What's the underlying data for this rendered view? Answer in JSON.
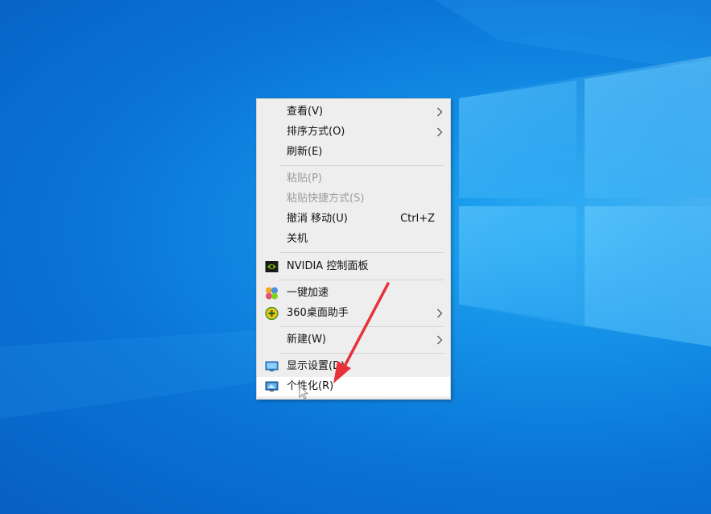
{
  "colors": {
    "desktop_accent": "#0a74d6",
    "menu_bg": "#eeeeee",
    "highlight_bg": "#ffffff",
    "disabled_text": "#9c9c9c",
    "annotation_red": "#e8323a"
  },
  "context_menu": {
    "view": "查看(V)",
    "sort_by": "排序方式(O)",
    "refresh": "刷新(E)",
    "paste": "粘贴(P)",
    "paste_shortcut": "粘贴快捷方式(S)",
    "undo_move": "撤消 移动(U)",
    "undo_shortcut": "Ctrl+Z",
    "shutdown": "关机",
    "nvidia": "NVIDIA 控制面板",
    "speedup": "一键加速",
    "desktop_helper": "360桌面助手",
    "new": "新建(W)",
    "display_settings": "显示设置(D)",
    "personalize": "个性化(R)"
  },
  "icons": {
    "nvidia": "nvidia-icon",
    "speedup": "speedup-icon",
    "desktop_helper": "360-helper-icon",
    "display_settings": "monitor-icon",
    "personalize": "personalize-icon"
  }
}
